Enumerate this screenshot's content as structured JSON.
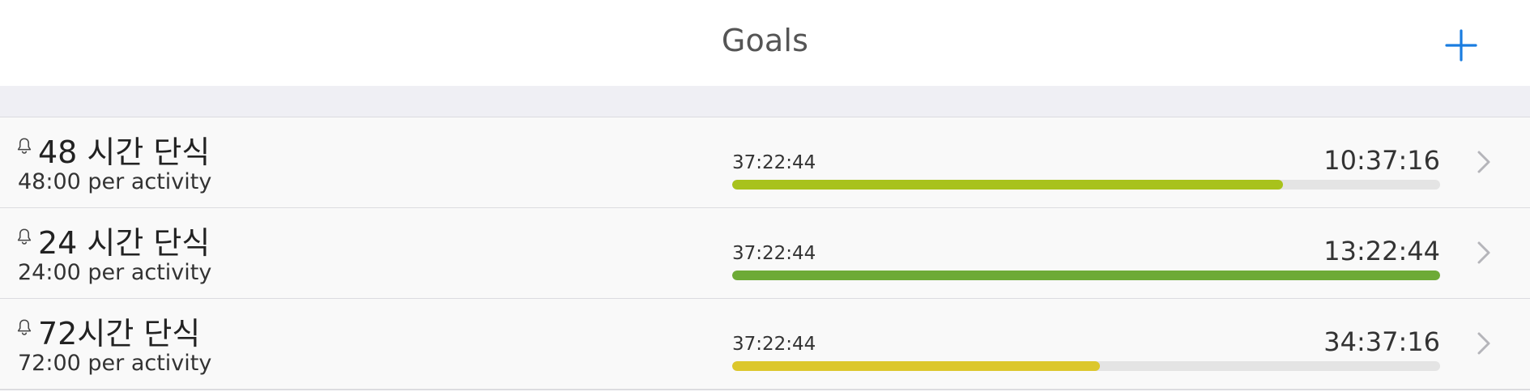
{
  "navbar": {
    "title": "Goals",
    "add_icon": "plus-icon",
    "accent_color": "#1a7de0"
  },
  "goals": [
    {
      "name": "48 시간 단식",
      "target": "48:00 per activity",
      "elapsed": "37:22:44",
      "remaining": "10:37:16",
      "progress": 0.778,
      "bar_color": "#a8c21c",
      "icon": "bell-icon"
    },
    {
      "name": "24 시간 단식",
      "target": "24:00 per activity",
      "elapsed": "37:22:44",
      "remaining": "13:22:44",
      "progress": 1.0,
      "bar_color": "#6daa36",
      "icon": "bell-icon"
    },
    {
      "name": "72시간 단식",
      "target": "72:00 per activity",
      "elapsed": "37:22:44",
      "remaining": "34:37:16",
      "progress": 0.519,
      "bar_color": "#dcc72c",
      "icon": "bell-icon"
    }
  ]
}
